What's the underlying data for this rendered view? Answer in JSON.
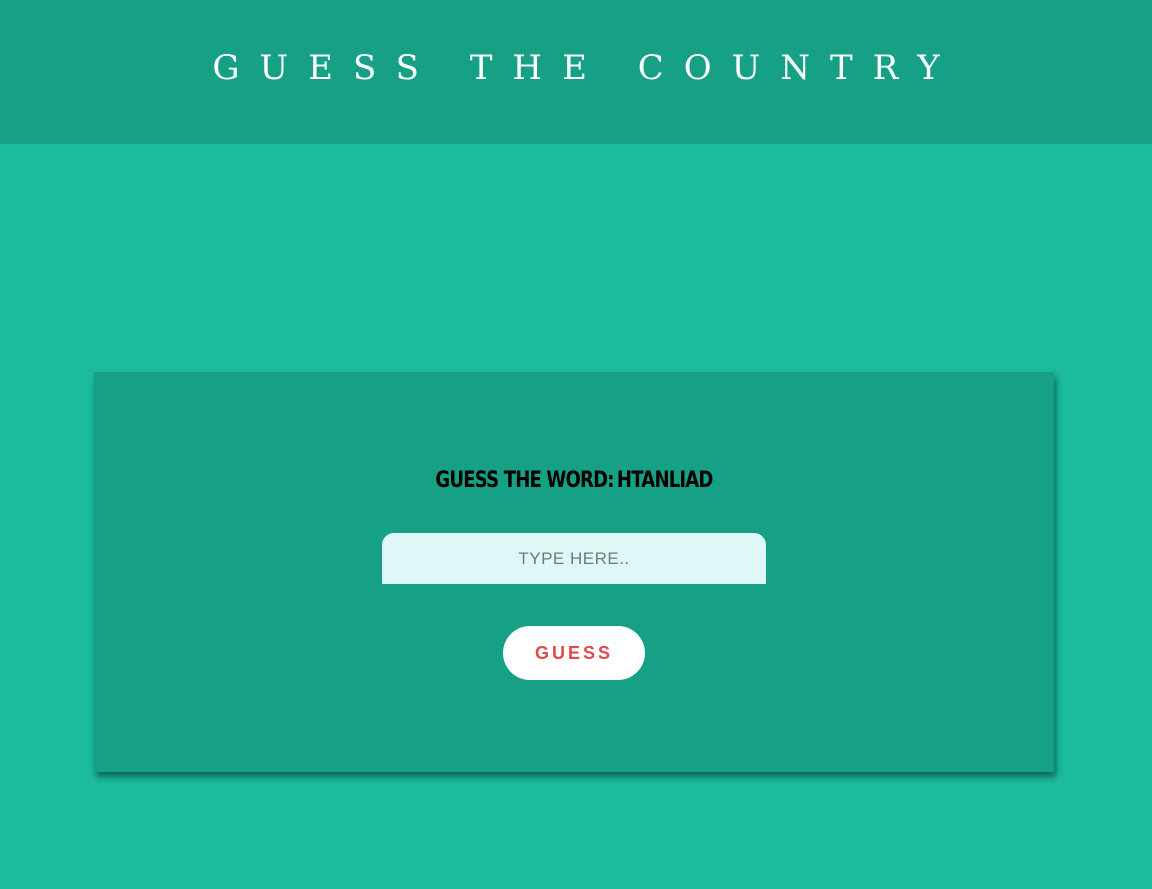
{
  "header": {
    "title": "Guess the Country"
  },
  "game": {
    "prompt_label": "GUESS THE WORD:",
    "scrambled_word": "HTANLIAD",
    "input": {
      "value": "",
      "placeholder": "TYPE HERE.."
    },
    "guess_button_label": "GUESS"
  },
  "colors": {
    "page_background": "#1abc9c",
    "header_background": "#16a085",
    "card_background": "#16a085",
    "input_background": "#e0f7f7",
    "button_text": "#e04a4a"
  }
}
